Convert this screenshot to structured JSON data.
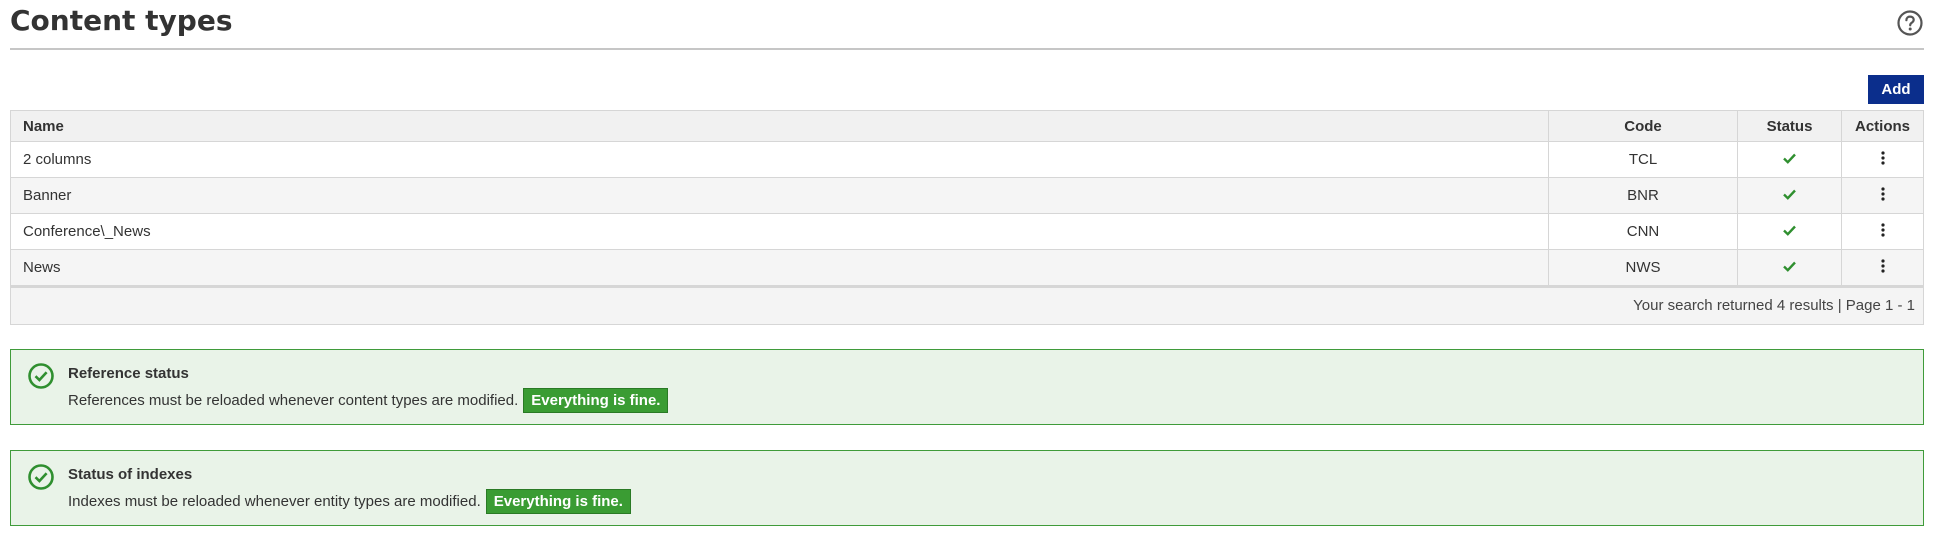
{
  "page": {
    "title": "Content types",
    "help_icon": "help-circle-icon"
  },
  "toolbar": {
    "add_label": "Add"
  },
  "table": {
    "columns": [
      "Name",
      "Code",
      "Status",
      "Actions"
    ],
    "rows": [
      {
        "name": "2 columns",
        "code": "TCL",
        "status": "check-icon",
        "actions": "kebab-menu-icon"
      },
      {
        "name": "Banner",
        "code": "BNR",
        "status": "check-icon",
        "actions": "kebab-menu-icon"
      },
      {
        "name": "Conference\\_News",
        "code": "CNN",
        "status": "check-icon",
        "actions": "kebab-menu-icon"
      },
      {
        "name": "News",
        "code": "NWS",
        "status": "check-icon",
        "actions": "kebab-menu-icon"
      }
    ],
    "footer": "Your search returned 4 results | Page 1 - 1"
  },
  "alerts": [
    {
      "title": "Reference status",
      "message": "References must be reloaded whenever content types are modified.",
      "badge": "Everything is fine.",
      "icon": "check-circle-icon"
    },
    {
      "title": "Status of indexes",
      "message": "Indexes must be reloaded whenever entity types are modified.",
      "badge": "Everything is fine.",
      "icon": "check-circle-icon"
    }
  ],
  "colors": {
    "primary_button": "#0b2e8c",
    "success": "#3a9c33",
    "success_bg": "#e9f3e8"
  }
}
